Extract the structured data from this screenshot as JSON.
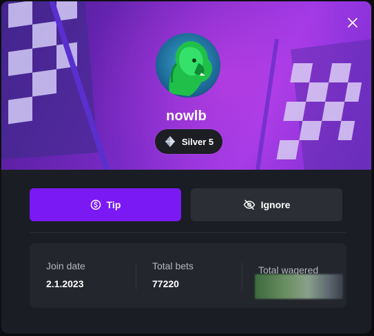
{
  "profile": {
    "username": "nowlb",
    "rank": "Silver 5"
  },
  "actions": {
    "tip_label": "Tip",
    "ignore_label": "Ignore"
  },
  "stats": {
    "join_date": {
      "label": "Join date",
      "value": "2.1.2023"
    },
    "total_bets": {
      "label": "Total bets",
      "value": "77220"
    },
    "total_wagered": {
      "label": "Total wagered"
    }
  },
  "icons": {
    "close": "close-icon",
    "rank": "diamond-rank-icon",
    "tip": "dollar-coin-icon",
    "ignore": "eye-off-icon",
    "avatar": "green-lion-avatar"
  },
  "colors": {
    "accent": "#7b19f5",
    "panel": "#1b1d24",
    "secondary_button": "#2b2e35",
    "stats_card": "#23262d"
  }
}
